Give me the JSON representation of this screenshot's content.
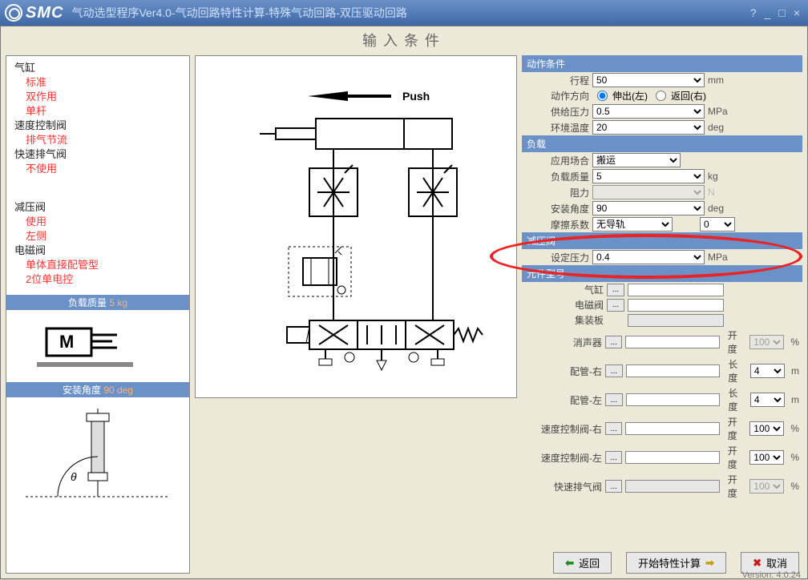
{
  "titlebar": {
    "app": "SMC",
    "title": "气动选型程序Ver4.0-气动回路特性计算-特殊气动回路-双压驱动回路",
    "help": "?",
    "minimize": "_",
    "maximize": "□",
    "close": "×"
  },
  "page_title": "输入条件",
  "tree": {
    "cylinder": "气缸",
    "cylinder_items": [
      "标准",
      "双作用",
      "单杆"
    ],
    "speed_valve": "速度控制阀",
    "speed_valve_items": [
      "排气节流"
    ],
    "quick_exhaust": "快速排气阀",
    "quick_exhaust_items": [
      "不使用"
    ],
    "reducer": "减压阀",
    "reducer_items": [
      "使用",
      "左侧"
    ],
    "solenoid": "电磁阀",
    "solenoid_items": [
      "单体直接配管型",
      "2位单电控"
    ]
  },
  "bars": {
    "load_mass_label": "负载质量",
    "load_mass_value": "5 kg",
    "angle_label": "安装角度",
    "angle_value": "90 deg"
  },
  "diagram": {
    "push": "Push",
    "motor": "M"
  },
  "sections": {
    "action": "动作条件",
    "load": "负载",
    "reducer": "减压阀",
    "model": "元件型号"
  },
  "action": {
    "stroke_label": "行程",
    "stroke_value": "50",
    "stroke_unit": "mm",
    "direction_label": "动作方向",
    "dir_out": "伸出(左)",
    "dir_in": "返回(右)",
    "supply_label": "供给压力",
    "supply_value": "0.5",
    "supply_unit": "MPa",
    "temp_label": "环境温度",
    "temp_value": "20",
    "temp_unit": "deg"
  },
  "load": {
    "application_label": "应用场合",
    "application_value": "搬运",
    "mass_label": "负载质量",
    "mass_value": "5",
    "mass_unit": "kg",
    "resist_label": "阻力",
    "resist_value": "",
    "resist_unit": "N",
    "angle_label": "安装角度",
    "angle_value": "90",
    "angle_unit": "deg",
    "friction_label": "摩擦系数",
    "friction_value": "无导轨",
    "friction_num": "0"
  },
  "reducer": {
    "set_label": "设定压力",
    "set_value": "0.4",
    "set_unit": "MPa"
  },
  "model": {
    "rows": [
      {
        "label": "气缸",
        "has_btn": true,
        "value": "",
        "extra": null
      },
      {
        "label": "电磁阀",
        "has_btn": true,
        "value": "",
        "extra": null
      },
      {
        "label": "集装板",
        "has_btn": false,
        "value": "",
        "gray": true,
        "extra": null
      },
      {
        "label": "消声器",
        "has_btn": true,
        "value": "",
        "extra": {
          "label": "开度",
          "value": "100",
          "unit": "%",
          "gray": true
        }
      },
      {
        "label": "配管-右",
        "has_btn": true,
        "value": "",
        "extra": {
          "label": "长度",
          "value": "4",
          "unit": "m"
        }
      },
      {
        "label": "配管-左",
        "has_btn": true,
        "value": "",
        "extra": {
          "label": "长度",
          "value": "4",
          "unit": "m"
        }
      },
      {
        "label": "速度控制阀-右",
        "has_btn": true,
        "value": "",
        "extra": {
          "label": "开度",
          "value": "100",
          "unit": "%"
        }
      },
      {
        "label": "速度控制阀-左",
        "has_btn": true,
        "value": "",
        "extra": {
          "label": "开度",
          "value": "100",
          "unit": "%"
        }
      },
      {
        "label": "快速排气阀",
        "has_btn": true,
        "value": "",
        "gray": true,
        "extra": {
          "label": "开度",
          "value": "100",
          "unit": "%",
          "gray": true
        }
      }
    ],
    "btn_label": "..."
  },
  "buttons": {
    "back": "返回",
    "calculate": "开始特性计算",
    "cancel": "取消"
  },
  "version": "Version: 4.0.24"
}
